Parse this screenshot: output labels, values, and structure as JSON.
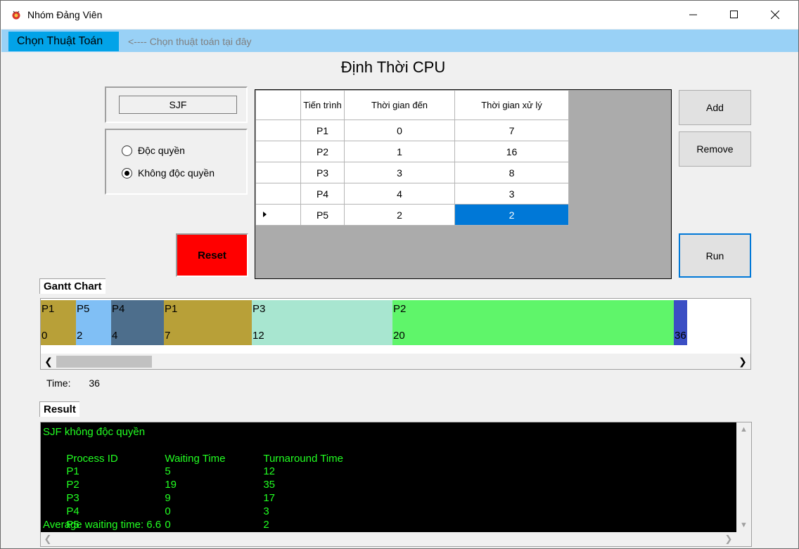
{
  "window": {
    "title": "Nhóm Đảng Viên"
  },
  "menu": {
    "item": "Chọn Thuật Toán",
    "hint": "<---- Chọn thuật toán tại đây"
  },
  "heading": "Định Thời CPU",
  "algorithm": "SJF",
  "modes": [
    {
      "label": "Độc quyền",
      "selected": false
    },
    {
      "label": "Không độc quyền",
      "selected": true
    }
  ],
  "buttons": {
    "reset": "Reset",
    "add": "Add",
    "remove": "Remove",
    "run": "Run"
  },
  "grid": {
    "headers": [
      "Tiến trình",
      "Thời gian đến",
      "Thời gian xử lý"
    ],
    "rows": [
      [
        "P1",
        "0",
        "7"
      ],
      [
        "P2",
        "1",
        "16"
      ],
      [
        "P3",
        "3",
        "8"
      ],
      [
        "P4",
        "4",
        "3"
      ],
      [
        "P5",
        "2",
        "2"
      ]
    ]
  },
  "gantt": {
    "label": "Gantt Chart",
    "segments": [
      {
        "name": "P1",
        "start": "0",
        "color": "#b8a038"
      },
      {
        "name": "P5",
        "start": "2",
        "color": "#80bff5"
      },
      {
        "name": "P4",
        "start": "4",
        "color": "#4d6e8c"
      },
      {
        "name": "P1",
        "start": "7",
        "color": "#b8a038"
      },
      {
        "name": "P3",
        "start": "12",
        "color": "#a8e6d0"
      },
      {
        "name": "P2",
        "start": "20",
        "color": "#5ff56a"
      },
      {
        "name": "",
        "start": "36",
        "color": "#3b4fc4"
      }
    ]
  },
  "time": {
    "label": "Time:",
    "value": "36"
  },
  "result": {
    "label": "Result",
    "title": "SJF không độc quyền",
    "headers": [
      "Process ID",
      "Waiting Time",
      "Turnaround Time"
    ],
    "rows": [
      [
        "P1",
        "5",
        "12"
      ],
      [
        "P2",
        "19",
        "35"
      ],
      [
        "P3",
        "9",
        "17"
      ],
      [
        "P4",
        "0",
        "3"
      ],
      [
        "P5",
        "0",
        "2"
      ]
    ],
    "average": "Average waiting time: 6.6"
  }
}
